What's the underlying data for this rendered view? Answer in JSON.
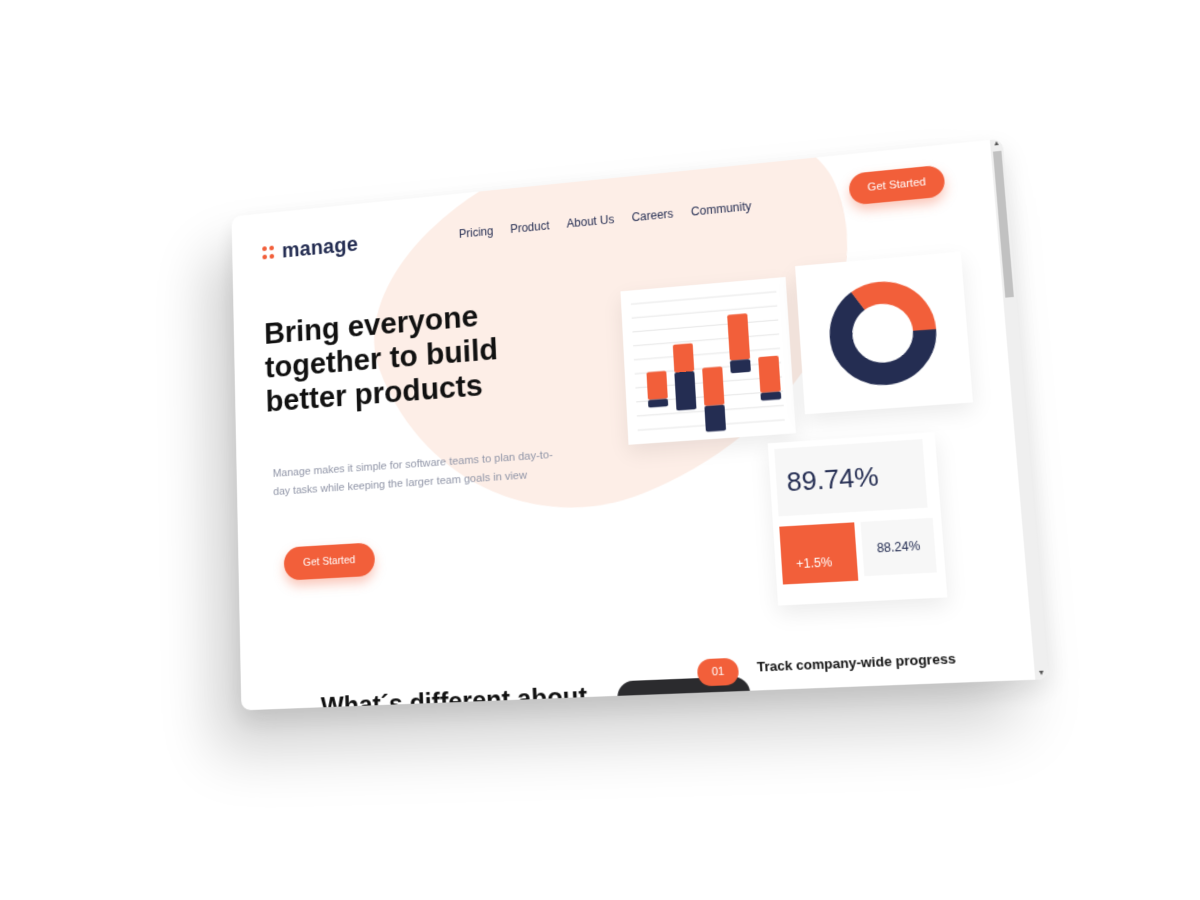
{
  "brand": {
    "name": "manage",
    "accent": "#f25f3a",
    "navy": "#242d52",
    "blob": "#fdeee7"
  },
  "nav": {
    "items": [
      "Pricing",
      "Product",
      "About Us",
      "Careers",
      "Community"
    ],
    "cta": "Get Started"
  },
  "hero": {
    "headline": "Bring everyone together to build better products",
    "subtext": "Manage makes it simple for software teams to plan day-to-day tasks while keeping the larger team goals in view",
    "cta": "Get Started"
  },
  "stats": {
    "main": "89.74%",
    "change": "+1.5%",
    "secondary": "88.24%"
  },
  "section": {
    "title": "What´s different about",
    "badge": "01",
    "feature_title": "Track company-wide progress"
  },
  "bar_widget": {
    "columns": [
      {
        "orange": 0.22,
        "navy": 0.06
      },
      {
        "orange": 0.22,
        "navy": 0.3
      },
      {
        "orange": 0.3,
        "navy": 0.2
      },
      {
        "orange": 0.36,
        "navy": 0.1
      },
      {
        "orange": 0.28,
        "navy": 0.06
      }
    ]
  },
  "donut_widget": {
    "navy_share": 0.66,
    "orange_share": 0.34
  }
}
